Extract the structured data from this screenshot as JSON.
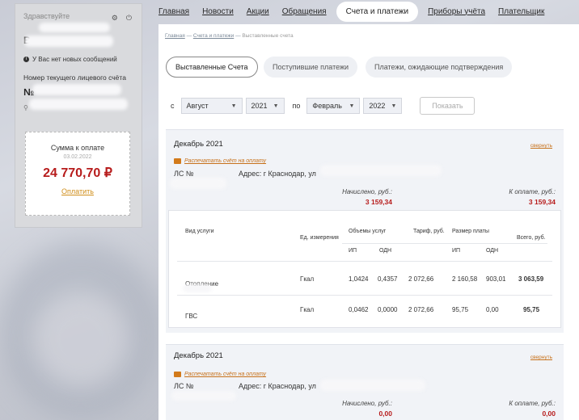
{
  "sidebar": {
    "greeting": "Здравствуйте",
    "initial": "В",
    "messages": "У Вас нет новых сообщений",
    "account_label": "Номер текущего лицевого счёта",
    "account_prefix": "№",
    "pay_box": {
      "title": "Сумма к оплате",
      "date": "03.02.2022",
      "amount": "24 770,70 ₽",
      "pay_link": "Оплатить"
    }
  },
  "nav": {
    "items": [
      "Главная",
      "Новости",
      "Акции",
      "Обращения",
      "Счета и платежи",
      "Приборы учёта",
      "Плательщик"
    ],
    "active": "Счета и платежи"
  },
  "breadcrumbs": [
    "Главная",
    "Счета и платежи",
    "Выставленные счета"
  ],
  "tabs": [
    "Выставленные Счета",
    "Поступившие платежи",
    "Платежи, ожидающие подтверждения"
  ],
  "filters": {
    "from_label": "с",
    "to_label": "по",
    "from_month": "Август",
    "from_year": "2021",
    "to_month": "Февраль",
    "to_year": "2022",
    "show_button": "Показать"
  },
  "bills": [
    {
      "title": "Декабрь 2021",
      "toggle": "свернуть",
      "print_link": "Распечатать счёт на оплату",
      "ls_label": "ЛС №",
      "address": "Адрес: г Краснодар, ул",
      "charged_label": "Начислено, руб.:",
      "charged_value": "3 159,34",
      "topay_label": "К оплате, руб.:",
      "topay_value": "3 159,34"
    },
    {
      "title": "Декабрь 2021",
      "toggle": "свернуть",
      "print_link": "Распечатать счёт на оплату",
      "ls_label": "ЛС №",
      "address": "Адрес: г Краснодар, ул",
      "charged_label": "Начислено, руб.:",
      "charged_value": "0,00",
      "topay_label": "К оплате, руб.:",
      "topay_value": "0,00"
    }
  ],
  "service_table": {
    "headers": {
      "service": "Вид услуги",
      "unit": "Ед. измерения",
      "volume": "Объемы услуг",
      "tariff": "Тариф, руб.",
      "payment": "Размер платы",
      "total": "Всего, руб.",
      "ip": "ИП",
      "odn": "ОДН"
    },
    "rows": [
      {
        "service": "Отопление",
        "unit": "Гкал",
        "vol_ip": "1,0424",
        "vol_odn": "0,4357",
        "tariff": "2 072,66",
        "pay_ip": "2 160,58",
        "pay_odn": "903,01",
        "total": "3 063,59"
      },
      {
        "service": "ГВС",
        "unit": "Гкал",
        "vol_ip": "0,0462",
        "vol_odn": "0,0000",
        "tariff": "2 072,66",
        "pay_ip": "95,75",
        "pay_odn": "0,00",
        "total": "95,75"
      }
    ]
  }
}
